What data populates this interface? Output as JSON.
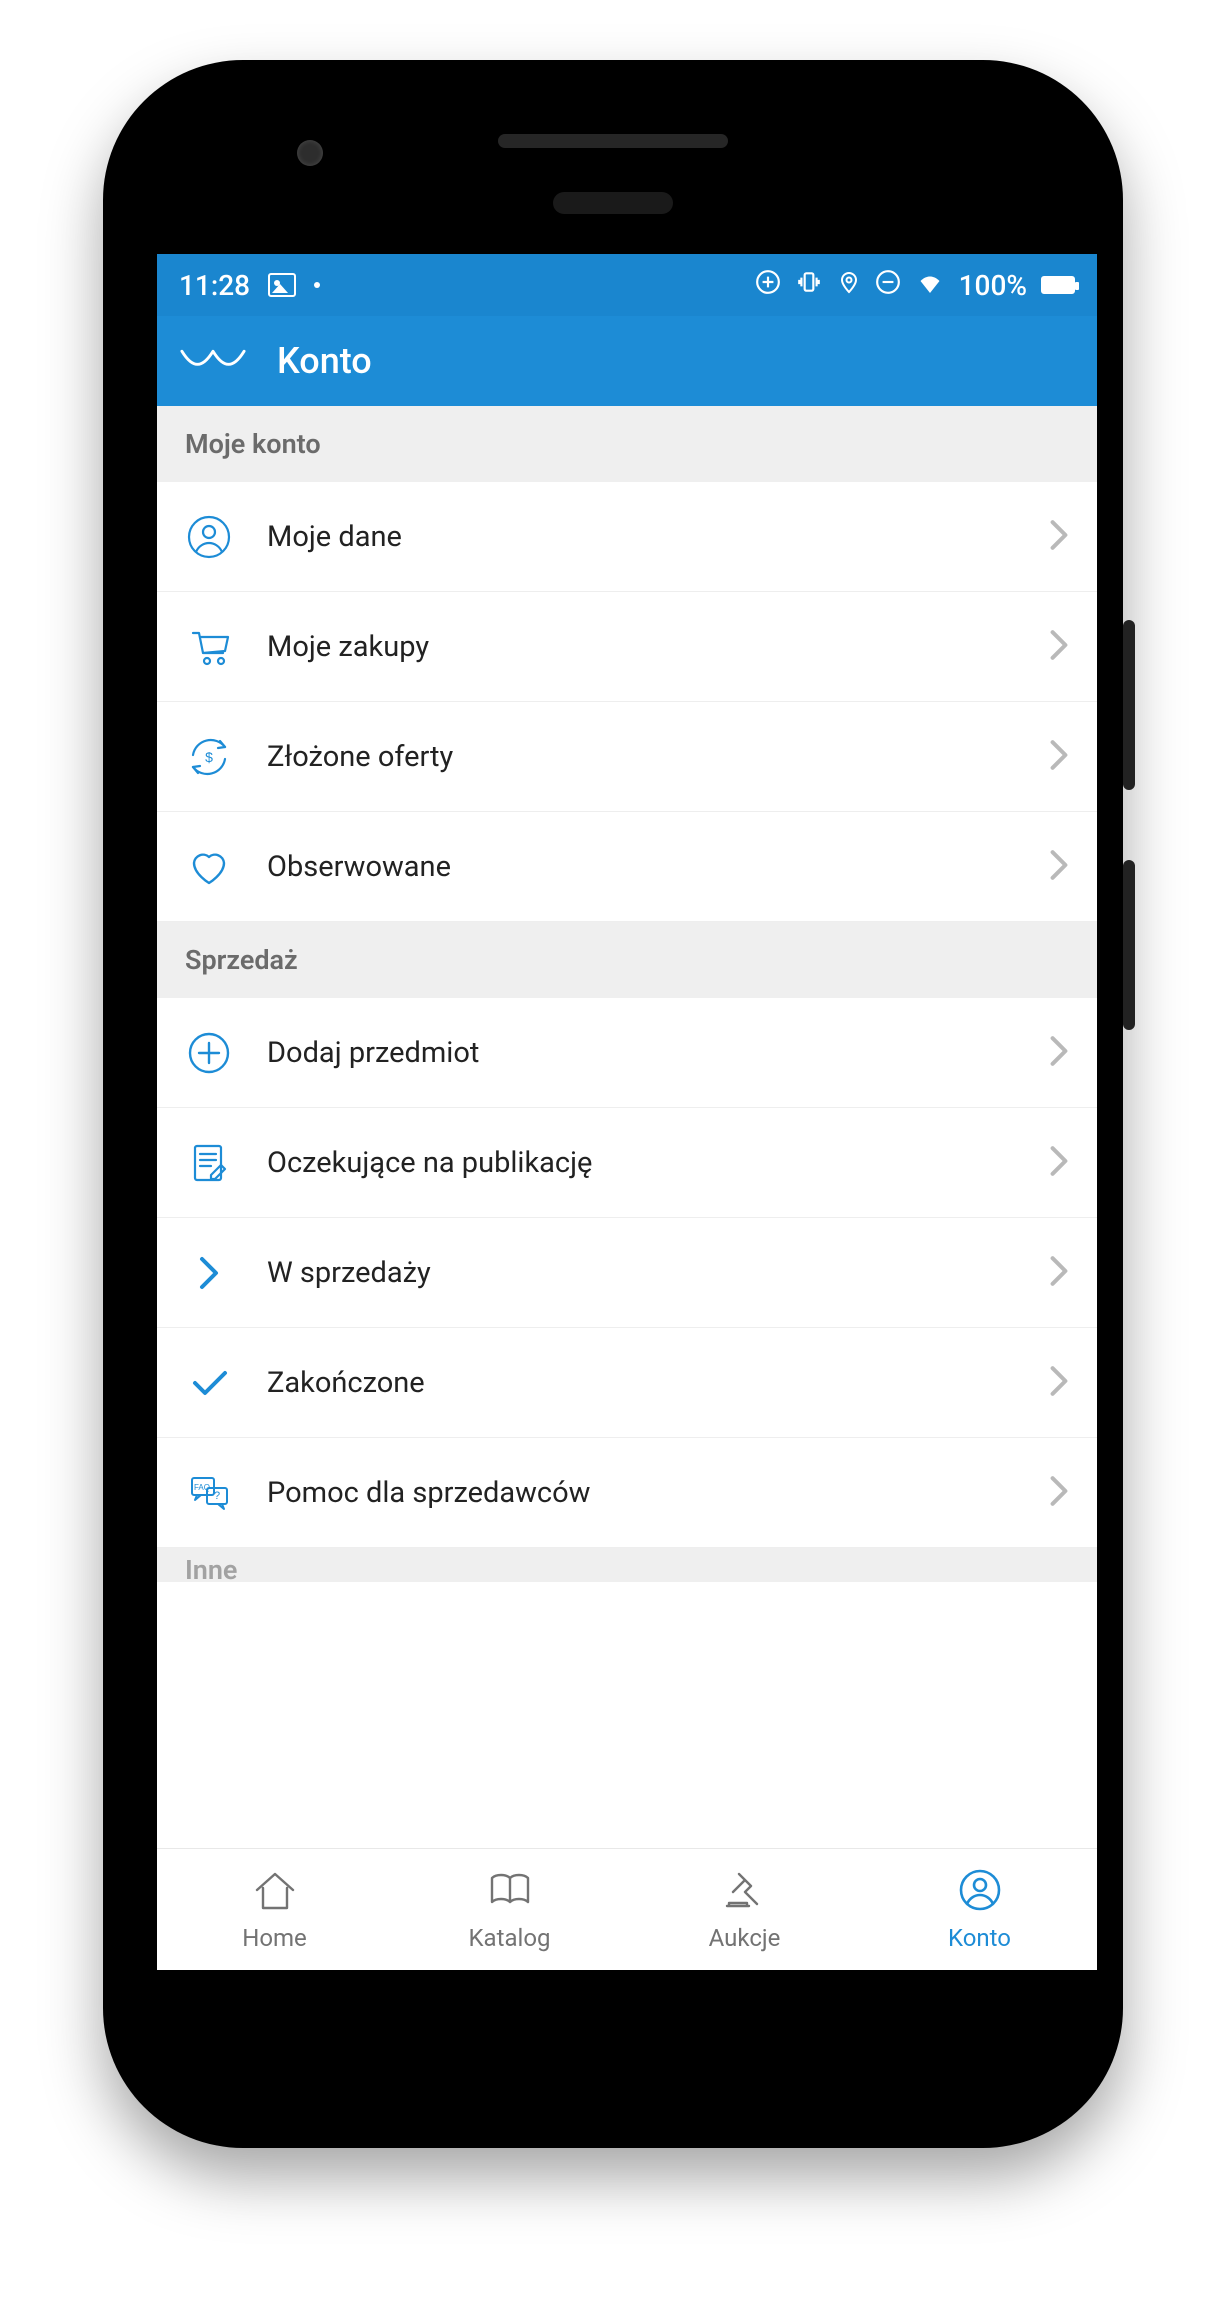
{
  "status": {
    "time": "11:28",
    "battery_pct": "100%"
  },
  "header": {
    "title": "Konto"
  },
  "sections": [
    {
      "title": "Moje konto",
      "items": [
        {
          "icon": "user-circle-icon",
          "label": "Moje dane"
        },
        {
          "icon": "cart-icon",
          "label": "Moje zakupy"
        },
        {
          "icon": "money-refresh-icon",
          "label": "Złożone oferty"
        },
        {
          "icon": "heart-icon",
          "label": "Obserwowane"
        }
      ]
    },
    {
      "title": "Sprzedaż",
      "items": [
        {
          "icon": "plus-circle-icon",
          "label": "Dodaj przedmiot"
        },
        {
          "icon": "document-edit-icon",
          "label": "Oczekujące na publikację"
        },
        {
          "icon": "chevron-right-blue-icon",
          "label": "W sprzedaży"
        },
        {
          "icon": "check-icon",
          "label": "Zakończone"
        },
        {
          "icon": "faq-bubble-icon",
          "label": "Pomoc dla sprzedawców"
        }
      ]
    },
    {
      "title": "Inne",
      "items": []
    }
  ],
  "nav": {
    "items": [
      {
        "icon": "home-icon",
        "label": "Home",
        "active": false
      },
      {
        "icon": "book-icon",
        "label": "Katalog",
        "active": false
      },
      {
        "icon": "gavel-icon",
        "label": "Aukcje",
        "active": false
      },
      {
        "icon": "user-circle-icon",
        "label": "Konto",
        "active": true
      }
    ]
  },
  "colors": {
    "accent": "#1d8cd6",
    "section_bg": "#efefef",
    "text": "#222222",
    "muted": "#737373"
  }
}
